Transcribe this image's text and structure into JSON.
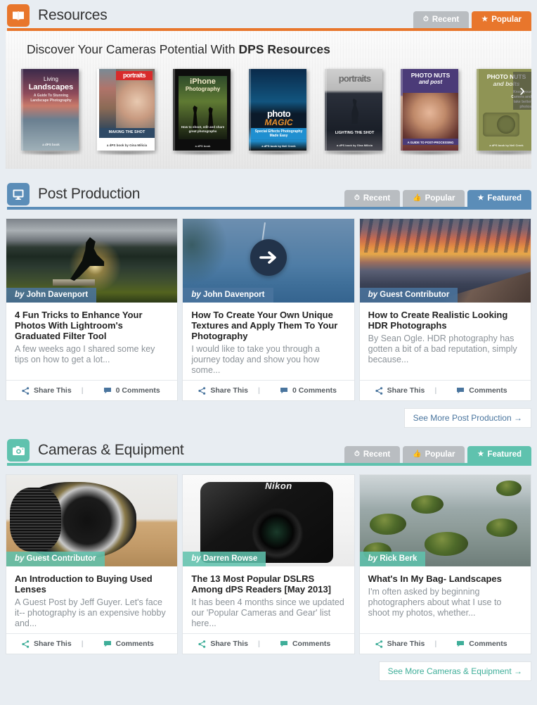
{
  "sections": {
    "resources": {
      "icon": "book-icon",
      "title": "Resources",
      "accent": "#e8762c",
      "tabs": [
        {
          "label": "Recent",
          "icon": "clock-icon",
          "active": false
        },
        {
          "label": "Popular",
          "icon": "star-icon",
          "active": true
        }
      ],
      "promo": {
        "text_prefix": "Discover Your Cameras Potential With ",
        "text_strong": "DPS Resources",
        "next_arrow": "›"
      },
      "books": [
        {
          "title_line1": "Living",
          "title_line2": "Landscapes",
          "subtitle": "A Guide To Stunning Landscape Photography",
          "footer": "a dPS book"
        },
        {
          "title_line1": "portraits",
          "title_line2": "",
          "subtitle": "MAKING THE SHOT",
          "footer": "a dPS book by Gina Milicia"
        },
        {
          "title_line1": "iPhone",
          "title_line2": "Photography",
          "subtitle": "How to shoot, edit and share great photographs",
          "footer": "a dPS book"
        },
        {
          "title_line1": "photo",
          "title_line2": "MAGIC",
          "subtitle": "Special Effects Photography Made Easy",
          "footer": "a dPS book by Neil Creek"
        },
        {
          "title_line1": "portraits",
          "title_line2": "",
          "subtitle": "LIGHTING THE SHOT",
          "footer": "a dPS book by Gina Milicia"
        },
        {
          "title_line1": "PHOTO NUTS",
          "title_line2": "and post",
          "subtitle": "A GUIDE TO POST-PROCESSING",
          "footer": "a dPS book by Neil Creek"
        },
        {
          "title_line1": "PHOTO NUTS",
          "title_line2": "and bolts",
          "subtitle": "Know your Camera and take better photos",
          "footer": "a dPS book by Neil Creek"
        }
      ]
    },
    "post_production": {
      "icon": "monitor-icon",
      "title": "Post Production",
      "accent": "#5b8db8",
      "tabs": [
        {
          "label": "Recent",
          "icon": "clock-icon",
          "active": false
        },
        {
          "label": "Popular",
          "icon": "thumb-up-icon",
          "active": false
        },
        {
          "label": "Featured",
          "icon": "star-icon",
          "active": true
        }
      ],
      "cards": [
        {
          "byline_prefix": "by",
          "author": "John Davenport",
          "title": "4 Fun Tricks to Enhance Your Photos With Lightroom's Graduated Filter Tool",
          "excerpt": "A few weeks ago I shared some key tips on how to get a lot...",
          "share_label": "Share This",
          "comments_label": "0 Comments",
          "image": "woman-silhouette-sunset-lake"
        },
        {
          "byline_prefix": "by",
          "author": "John Davenport",
          "title": "How To Create Your Own Unique Textures and Apply Them To Your Photography",
          "excerpt": "I would like to take you through a journey today and show you how some...",
          "share_label": "Share This",
          "comments_label": "0 Comments",
          "image": "stormy-sky-with-play-button"
        },
        {
          "byline_prefix": "by",
          "author": "Guest Contributor",
          "title": "How to Create Realistic Looking HDR Photographs",
          "excerpt": "By Sean Ogle. HDR photography has gotten a bit of a bad reputation, simply because...",
          "share_label": "Share This",
          "comments_label": "Comments",
          "image": "sunset-dock-harbor"
        }
      ],
      "see_more": "See More Post Production  →"
    },
    "cameras": {
      "icon": "camera-icon",
      "title": "Cameras & Equipment",
      "accent": "#5fc2ae",
      "tabs": [
        {
          "label": "Recent",
          "icon": "clock-icon",
          "active": false
        },
        {
          "label": "Popular",
          "icon": "thumb-up-icon",
          "active": false
        },
        {
          "label": "Featured",
          "icon": "star-icon",
          "active": true
        }
      ],
      "cards": [
        {
          "byline_prefix": "by",
          "author": "Guest Contributor",
          "title": "An Introduction to Buying Used Lenses",
          "excerpt": "A Guest Post by Jeff Guyer. Let's face it-- photography is an expensive hobby and...",
          "share_label": "Share This",
          "comments_label": "Comments",
          "image": "camera-lens-on-table"
        },
        {
          "byline_prefix": "by",
          "author": "Darren Rowse",
          "title": "The 13 Most Popular DSLRS Among dPS Readers [May 2013]",
          "excerpt": "It has been 4 months since we updated our 'Popular Cameras and Gear' list here...",
          "share_label": "Share This",
          "comments_label": "Comments",
          "image": "nikon-dslr-camera"
        },
        {
          "byline_prefix": "by",
          "author": "Rick Berk",
          "title": "What's In My Bag- Landscapes",
          "excerpt": "I'm often asked by beginning photographers about what I use to shoot my photos, whether...",
          "share_label": "Share This",
          "comments_label": "Comments",
          "image": "mossy-rocks-stream"
        }
      ],
      "see_more": "See More Cameras & Equipment  →"
    }
  }
}
